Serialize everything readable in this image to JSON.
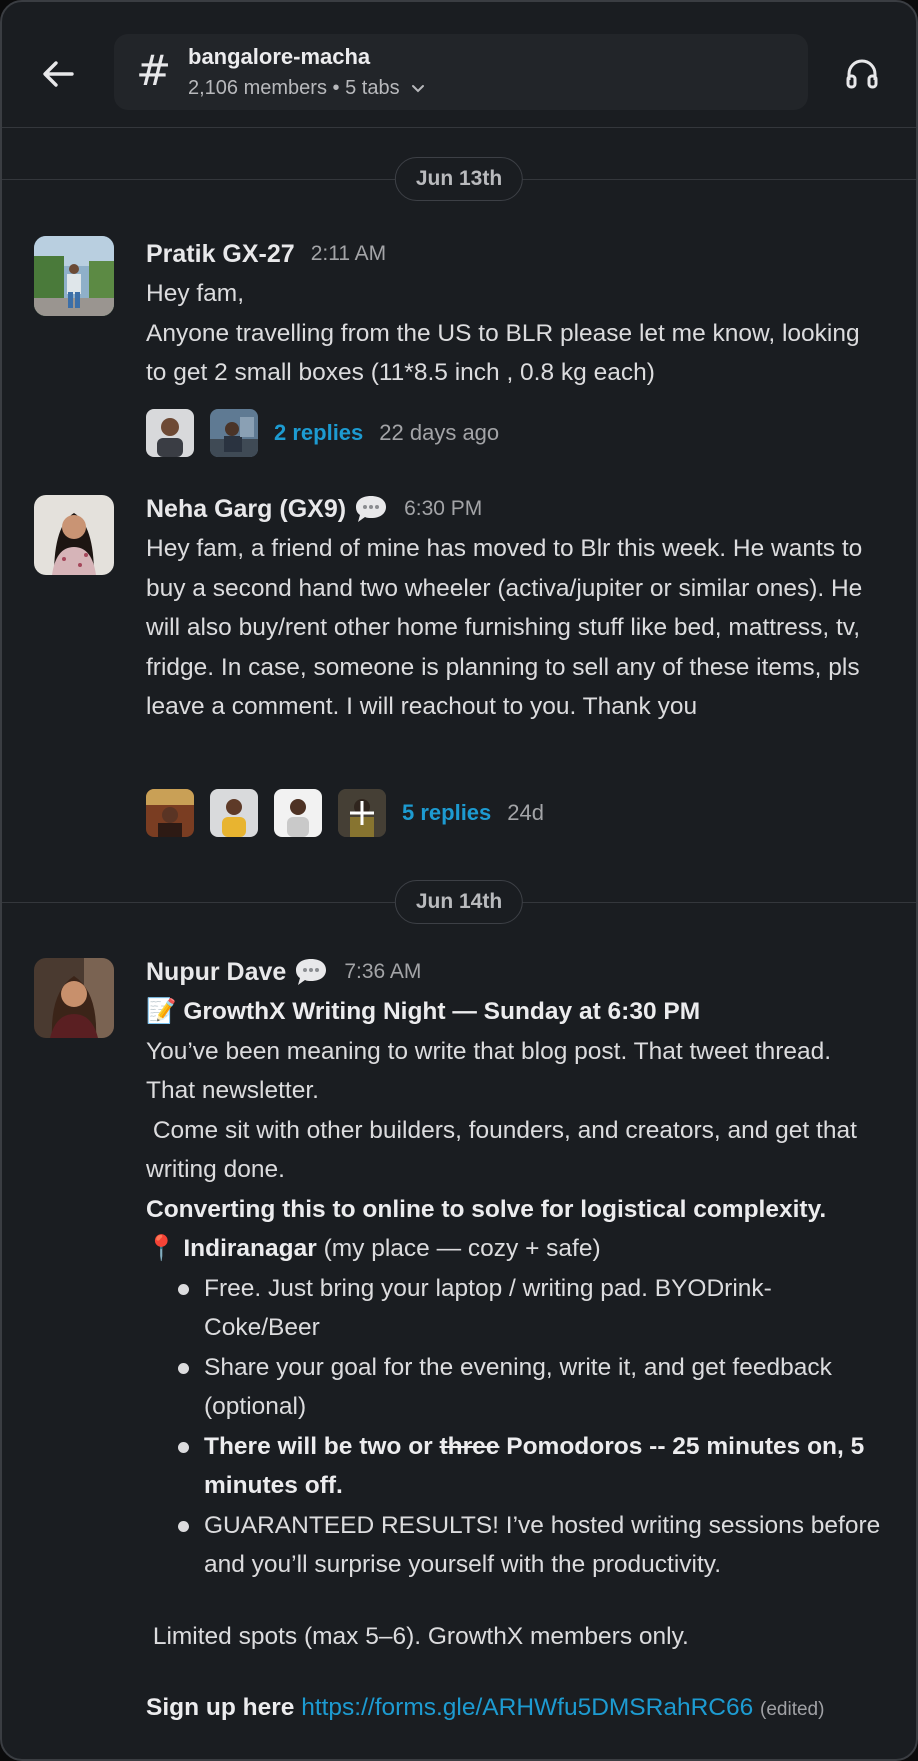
{
  "header": {
    "channel_name": "bangalore-macha",
    "members": "2,106 members",
    "tabs": "5 tabs",
    "hash": "#"
  },
  "days": [
    {
      "label": "Jun 13th"
    },
    {
      "label": "Jun 14th"
    }
  ],
  "messages": [
    {
      "author": "Pratik GX-27",
      "time": "2:11 AM",
      "lines": [
        "Hey fam,",
        "Anyone travelling from the US to BLR please let me know, looking to get 2 small boxes (11*8.5 inch , 0.8 kg each)"
      ],
      "thread": {
        "replies": "2 replies",
        "ago": "22 days ago"
      }
    },
    {
      "author": "Neha Garg (GX9)",
      "time": "6:30 PM",
      "text": "Hey fam, a friend of mine has moved to Blr this week. He wants to buy a second hand two wheeler (activa/jupiter or similar ones). He will also buy/rent other home furnishing stuff like bed, mattress, tv, fridge. In case, someone is planning to sell any of these items, pls leave a comment. I will reachout to you. Thank you",
      "thread": {
        "replies": "5 replies",
        "ago": "24d"
      }
    },
    {
      "author": "Nupur Dave",
      "time": "7:36 AM",
      "title_emoji": "📝",
      "title": "GrowthX Writing Night — Sunday at 6:30 PM",
      "para1": "You’ve been meaning to write that blog post. That tweet thread. That newsletter.",
      "para2": " Come sit with other builders, founders, and creators, and get that writing done.",
      "bold_line": "Converting this to online to solve for logistical complexity.",
      "pin_emoji": "📍",
      "location": "Indiranagar",
      "location_note": " (my place — cozy + safe)",
      "bullets": [
        "Free. Just bring your laptop / writing pad.  BYODrink- Coke/Beer",
        "Share your goal for the evening, write it, and get feedback (optional)"
      ],
      "bullet3_a": "There will be two or ",
      "bullet3_strike": "three",
      "bullet3_b": " Pomodoros -- 25 minutes on, 5 minutes off.",
      "bullet4": "GUARANTEED RESULTS! I’ve hosted writing sessions before and you’ll surprise yourself with the productivity.",
      "limited": " Limited spots (max 5–6). GrowthX members only.",
      "signup_label": "Sign up here ",
      "signup_link": "https://forms.gle/ARHWfu5DMSRahRC66",
      "edited": "(edited)"
    }
  ],
  "colors": {
    "background": "#1a1d21",
    "link": "#1d9bd1",
    "text": "#dcdcde"
  }
}
